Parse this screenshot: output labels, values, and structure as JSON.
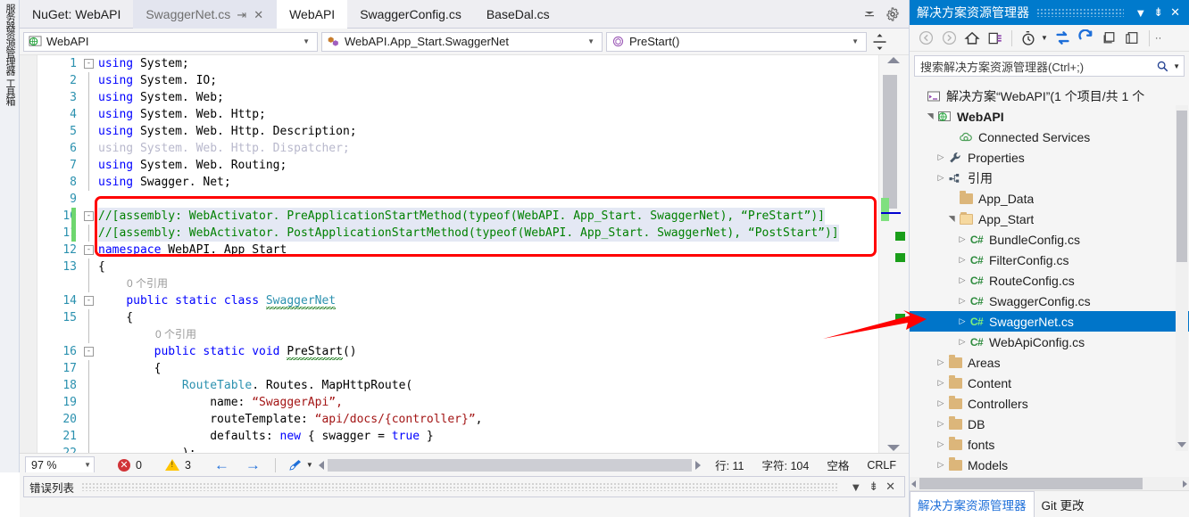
{
  "left_dock": {
    "items": [
      {
        "label": "服务器资源管理器",
        "name": "server-explorer"
      },
      {
        "label": "工具箱",
        "name": "toolbox"
      }
    ]
  },
  "editor": {
    "tabs": [
      {
        "label": "NuGet: WebAPI",
        "state": "normal"
      },
      {
        "label": "SwaggerNet.cs",
        "state": "selected",
        "pin": "⇥",
        "close": "✕"
      },
      {
        "label": "WebAPI",
        "state": "active"
      },
      {
        "label": "SwaggerConfig.cs",
        "state": "normal"
      },
      {
        "label": "BaseDal.cs",
        "state": "normal"
      }
    ],
    "tab_overflow_icon": "chevron-down-icon",
    "tab_settings_icon": "gear-icon",
    "nav_bar": {
      "project": "WebAPI",
      "type": "WebAPI.App_Start.SwaggerNet",
      "member": "PreStart()",
      "split_icon": "split-view-icon"
    },
    "lines": [
      {
        "num": "1",
        "glyph": "-",
        "vline": false,
        "tokens": [
          {
            "t": "using ",
            "c": "kw"
          },
          {
            "t": "System;",
            "c": "pln"
          }
        ]
      },
      {
        "num": "2",
        "glyph": "",
        "vline": true,
        "tokens": [
          {
            "t": "using ",
            "c": "kw"
          },
          {
            "t": "System. IO;",
            "c": "pln"
          }
        ]
      },
      {
        "num": "3",
        "glyph": "",
        "vline": true,
        "tokens": [
          {
            "t": "using ",
            "c": "kw"
          },
          {
            "t": "System. Web;",
            "c": "pln"
          }
        ]
      },
      {
        "num": "4",
        "glyph": "",
        "vline": true,
        "tokens": [
          {
            "t": "using ",
            "c": "kw"
          },
          {
            "t": "System. Web. Http;",
            "c": "pln"
          }
        ]
      },
      {
        "num": "5",
        "glyph": "",
        "vline": true,
        "tokens": [
          {
            "t": "using ",
            "c": "kw"
          },
          {
            "t": "System. Web. Http. Description;",
            "c": "pln"
          }
        ]
      },
      {
        "num": "6",
        "glyph": "",
        "vline": true,
        "tokens": [
          {
            "t": "using System. Web. Http. Dispatcher;",
            "c": "dim"
          }
        ]
      },
      {
        "num": "7",
        "glyph": "",
        "vline": true,
        "tokens": [
          {
            "t": "using ",
            "c": "kw"
          },
          {
            "t": "System. Web. Routing;",
            "c": "pln"
          }
        ]
      },
      {
        "num": "8",
        "glyph": "",
        "vline": true,
        "tokens": [
          {
            "t": "using ",
            "c": "kw"
          },
          {
            "t": "Swagger. Net;",
            "c": "pln"
          }
        ]
      },
      {
        "num": "9",
        "glyph": "",
        "vline": false,
        "tokens": []
      },
      {
        "num": "10",
        "glyph": "-",
        "vline": false,
        "changebar": true,
        "sel": true,
        "tokens": [
          {
            "t": "//[assembly: WebActivator. PreApplicationStartMethod(typeof(WebAPI. App_Start. SwaggerNet), “PreStart”)]",
            "c": "cmt"
          }
        ]
      },
      {
        "num": "11",
        "glyph": "",
        "vline": true,
        "changebar": true,
        "sel": true,
        "tokens": [
          {
            "t": "//[assembly: WebActivator. PostApplicationStartMethod(typeof(WebAPI. App_Start. SwaggerNet), “PostStart”)]",
            "c": "cmt"
          }
        ]
      },
      {
        "num": "12",
        "glyph": "-",
        "vline": false,
        "tokens": [
          {
            "t": "namespace ",
            "c": "kw"
          },
          {
            "t": "WebAPI. App_Start",
            "c": "pln"
          }
        ]
      },
      {
        "num": "13",
        "glyph": "",
        "vline": true,
        "tokens": [
          {
            "t": "{",
            "c": "pln"
          }
        ]
      },
      {
        "num": "",
        "codelens": "0 个引用",
        "indent": 100
      },
      {
        "num": "14",
        "glyph": "-",
        "vline": true,
        "tokens": [
          {
            "t": "    ",
            "c": "pln"
          },
          {
            "t": "public static class ",
            "c": "kw"
          },
          {
            "t": "SwaggerNet",
            "c": "squiggle"
          }
        ]
      },
      {
        "num": "15",
        "glyph": "",
        "vline": true,
        "tokens": [
          {
            "t": "    {",
            "c": "pln"
          }
        ]
      },
      {
        "num": "",
        "codelens": "0 个引用",
        "indent": 132
      },
      {
        "num": "16",
        "glyph": "-",
        "vline": true,
        "tokens": [
          {
            "t": "        ",
            "c": "pln"
          },
          {
            "t": "public static void ",
            "c": "kw"
          },
          {
            "t": "PreStart",
            "c": "squiggle-p"
          },
          {
            "t": "()",
            "c": "pln"
          }
        ]
      },
      {
        "num": "17",
        "glyph": "",
        "vline": true,
        "tokens": [
          {
            "t": "        {",
            "c": "pln"
          }
        ]
      },
      {
        "num": "18",
        "glyph": "",
        "vline": true,
        "tokens": [
          {
            "t": "            ",
            "c": "pln"
          },
          {
            "t": "RouteTable",
            "c": "typ"
          },
          {
            "t": ". Routes. MapHttpRoute(",
            "c": "pln"
          }
        ]
      },
      {
        "num": "19",
        "glyph": "",
        "vline": true,
        "tokens": [
          {
            "t": "                name: ",
            "c": "pln"
          },
          {
            "t": "“SwaggerApi”,",
            "c": "str"
          }
        ]
      },
      {
        "num": "20",
        "glyph": "",
        "vline": true,
        "tokens": [
          {
            "t": "                routeTemplate: ",
            "c": "pln"
          },
          {
            "t": "“api/docs/{controller}”",
            "c": "str"
          },
          {
            "t": ",",
            "c": "pln"
          }
        ]
      },
      {
        "num": "21",
        "glyph": "",
        "vline": true,
        "tokens": [
          {
            "t": "                defaults: ",
            "c": "pln"
          },
          {
            "t": "new ",
            "c": "kw"
          },
          {
            "t": "{ swagger = ",
            "c": "pln"
          },
          {
            "t": "true ",
            "c": "kw"
          },
          {
            "t": "}",
            "c": "pln"
          }
        ]
      },
      {
        "num": "22",
        "glyph": "",
        "vline": true,
        "tokens": [
          {
            "t": "            );",
            "c": "pln"
          }
        ]
      }
    ],
    "annotation": {
      "red_box": true,
      "red_arrow": true
    },
    "status": {
      "zoom": "97 %",
      "error_count": "0",
      "warning_count": "3",
      "back_arrow": "←",
      "forward_arrow": "→",
      "brush_icon": "clear-formatting-icon",
      "line_label": "行: 11",
      "char_label": "字符: 104",
      "space_label": "空格",
      "eol_label": "CRLF"
    }
  },
  "bottom_panel": {
    "title": "错误列表",
    "dropdown_icon": "chevron-down-icon",
    "pin_icon": "pin-icon",
    "close_icon": "close-icon"
  },
  "solution_explorer": {
    "title": "解决方案资源管理器",
    "dropdown_icon": "chevron-down-icon",
    "pin_icon": "pin-icon",
    "close_icon": "close-icon",
    "toolbar": [
      {
        "name": "back-icon",
        "glyph": "◀"
      },
      {
        "name": "forward-icon",
        "glyph": "▶"
      },
      {
        "name": "home-icon",
        "glyph": "⌂"
      },
      {
        "name": "pending-changes-icon",
        "glyph": "▣"
      },
      {
        "name": "history-icon",
        "glyph": "◷"
      },
      {
        "name": "sync-icon",
        "glyph": "⇄"
      },
      {
        "name": "refresh-icon",
        "glyph": "↻"
      },
      {
        "name": "collapse-all-icon",
        "glyph": "⊟"
      },
      {
        "name": "properties-icon",
        "glyph": "▤"
      },
      {
        "name": "overflow-icon",
        "glyph": "»"
      }
    ],
    "search_placeholder": "搜索解决方案资源管理器(Ctrl+;)",
    "search_icon": "search-icon",
    "search_dropdown_icon": "chevron-down-icon",
    "tree": [
      {
        "label": "解决方案“WebAPI”(1 个项目/共 1 个",
        "indent": 4,
        "expander": "",
        "icon": "solution",
        "bold": false
      },
      {
        "label": "WebAPI",
        "indent": 16,
        "expander": "▲",
        "icon": "web-project",
        "bold": true
      },
      {
        "label": "Connected Services",
        "indent": 40,
        "expander": "",
        "icon": "cloud",
        "bold": false
      },
      {
        "label": "Properties",
        "indent": 28,
        "expander": "▶",
        "icon": "wrench",
        "bold": false
      },
      {
        "label": "引用",
        "indent": 28,
        "expander": "▶",
        "icon": "references",
        "bold": false
      },
      {
        "label": "App_Data",
        "indent": 40,
        "expander": "",
        "icon": "folder",
        "bold": false
      },
      {
        "label": "App_Start",
        "indent": 40,
        "expander": "▲",
        "icon": "folder-open",
        "bold": false
      },
      {
        "label": "BundleConfig.cs",
        "indent": 52,
        "expander": "▶",
        "icon": "cs",
        "bold": false
      },
      {
        "label": "FilterConfig.cs",
        "indent": 52,
        "expander": "▶",
        "icon": "cs",
        "bold": false
      },
      {
        "label": "RouteConfig.cs",
        "indent": 52,
        "expander": "▶",
        "icon": "cs",
        "bold": false
      },
      {
        "label": "SwaggerConfig.cs",
        "indent": 52,
        "expander": "▶",
        "icon": "cs",
        "bold": false
      },
      {
        "label": "SwaggerNet.cs",
        "indent": 52,
        "expander": "▶",
        "icon": "cs",
        "bold": false,
        "selected": true
      },
      {
        "label": "WebApiConfig.cs",
        "indent": 52,
        "expander": "▶",
        "icon": "cs",
        "bold": false
      },
      {
        "label": "Areas",
        "indent": 28,
        "expander": "▶",
        "icon": "folder",
        "bold": false
      },
      {
        "label": "Content",
        "indent": 28,
        "expander": "▶",
        "icon": "folder",
        "bold": false
      },
      {
        "label": "Controllers",
        "indent": 28,
        "expander": "▶",
        "icon": "folder",
        "bold": false
      },
      {
        "label": "DB",
        "indent": 28,
        "expander": "▶",
        "icon": "folder",
        "bold": false
      },
      {
        "label": "fonts",
        "indent": 28,
        "expander": "▶",
        "icon": "folder",
        "bold": false
      },
      {
        "label": "Models",
        "indent": 28,
        "expander": "▶",
        "icon": "folder",
        "bold": false
      }
    ],
    "tabs": [
      {
        "label": "解决方案资源管理器",
        "active": true
      },
      {
        "label": "Git 更改",
        "active": false
      }
    ]
  },
  "colors": {
    "accent": "#007acc",
    "selection": "#0075c9",
    "annotation_red": "#ff0000",
    "keyword_blue": "#0000ff",
    "comment_green": "#008000",
    "string_red": "#a31515",
    "type_teal": "#2b91af"
  }
}
